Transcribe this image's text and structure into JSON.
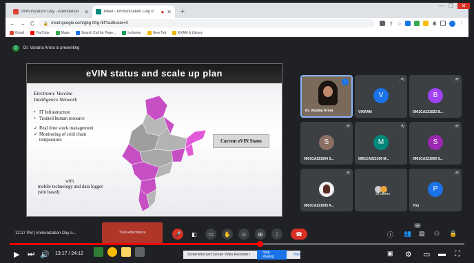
{
  "browser": {
    "tabs": [
      {
        "title": "Immunization Day - Attendance",
        "active": false,
        "favicon_color": "#db4437"
      },
      {
        "title": "Meet - Immunization Day o",
        "active": true,
        "favicon_color": "#00897b"
      }
    ],
    "url": "meet.google.com/gbg-tthg-fkf?authuser=0",
    "bookmarks": [
      {
        "label": "Gmail",
        "color": "#db4437"
      },
      {
        "label": "YouTube",
        "color": "#ff0000"
      },
      {
        "label": "Maps",
        "color": "#34a853"
      },
      {
        "label": "Search Call for Pape...",
        "color": "#1a73e8"
      },
      {
        "label": "Inclusion",
        "color": "#0f9d58"
      },
      {
        "label": "New Tab",
        "color": "#f4b400"
      },
      {
        "label": "EXAM & Library",
        "color": "#f4b400"
      }
    ]
  },
  "meet": {
    "presenting_text": "Dr. Vandna Arora is presenting",
    "presenter_initial": "D"
  },
  "slide": {
    "title": "eVIN status and scale up plan",
    "subtitle": "Electronic Vaccine Intelligence Network",
    "bullets": [
      {
        "text": "IT Infrastructure",
        "type": "dot"
      },
      {
        "text": "Trained human resource",
        "type": "dot"
      },
      {
        "text": "Real time stock management",
        "type": "check"
      },
      {
        "text": "Monitoring of cold chain temperature",
        "type": "check"
      }
    ],
    "footer_line1": "with",
    "footer_line2": "mobile technology and data logger (sim based)",
    "legend_box": "Current eVIN States"
  },
  "participants": [
    {
      "name": "Dr. Vandna Arora",
      "initial": "",
      "color": "",
      "speaker": true
    },
    {
      "name": "VIKRAM",
      "initial": "V",
      "color": "#1a73e8"
    },
    {
      "name": "0901CA221022 B...",
      "initial": "B",
      "color": "#a142f4"
    },
    {
      "name": "0901CA221054 S...",
      "initial": "S",
      "color": "#8d6e63"
    },
    {
      "name": "0901CA221036 M...",
      "initial": "M",
      "color": "#00897b"
    },
    {
      "name": "0901CA221059 S...",
      "initial": "S",
      "color": "#9c27b0"
    },
    {
      "name": "0901CA221005 A...",
      "initial": "",
      "color": "#ffffff"
    },
    {
      "name": "39 others",
      "initial": "",
      "color": ""
    },
    {
      "name": "You",
      "initial": "P",
      "color": "#1a73e8"
    }
  ],
  "meetbar": {
    "time_title": "12:17 PM  |  Immunization Day o...",
    "track_label": "Track Attendance",
    "participant_count": "45"
  },
  "player": {
    "current_time": "13:17 / 24:12",
    "progress_fraction": 0.55
  },
  "sharing": {
    "text": "Screenshot and Screen Video Recorder is sharing your screen.",
    "stop_label": "Stop sharing",
    "hide_label": "Hide"
  }
}
